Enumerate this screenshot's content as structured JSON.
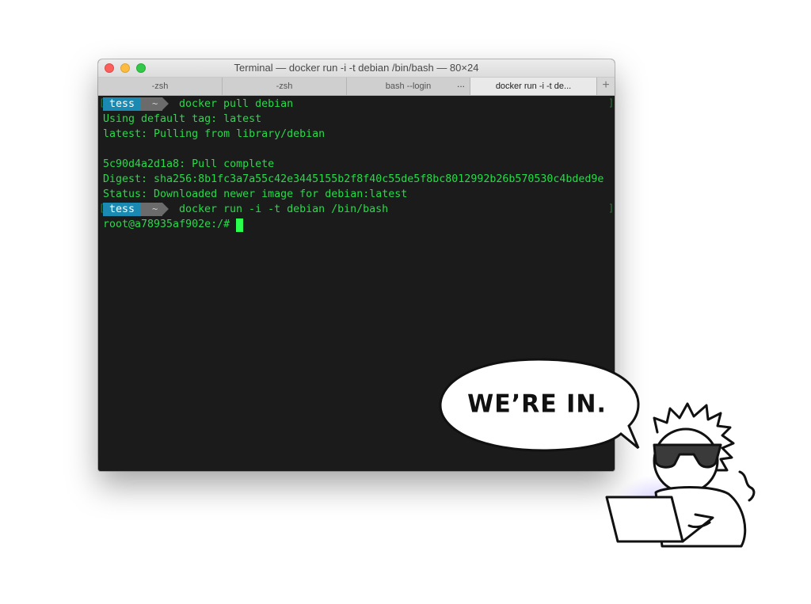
{
  "window": {
    "title": "Terminal — docker run -i -t debian /bin/bash — 80×24"
  },
  "tabs": [
    {
      "label": "-zsh",
      "active": false
    },
    {
      "label": "-zsh",
      "active": false
    },
    {
      "label": "bash --login",
      "active": false,
      "extra": "..."
    },
    {
      "label": "docker run -i -t de...",
      "active": true
    }
  ],
  "new_tab_label": "+",
  "terminal": {
    "prompt1": {
      "user": "tess",
      "dir": "~",
      "command": "docker pull debian"
    },
    "output": [
      "Using default tag: latest",
      "latest: Pulling from library/debian",
      "",
      "5c90d4a2d1a8: Pull complete",
      "Digest: sha256:8b1fc3a7a55c42e3445155b2f8f40c55de5f8bc8012992b26b570530c4bded9e",
      "Status: Downloaded newer image for debian:latest"
    ],
    "prompt2": {
      "user": "tess",
      "dir": "~",
      "command": "docker run -i -t debian /bin/bash"
    },
    "root_prompt": "root@a78935af902e:/# ",
    "bracket_left": "[",
    "bracket_right": "]"
  },
  "comic": {
    "speech": "WE’RE IN."
  },
  "colors": {
    "terminal_bg": "#1b1b1b",
    "terminal_text": "#28d94a",
    "prompt_user_bg": "#1b8ab2",
    "prompt_dir_bg": "#6b6b6b",
    "cursor": "#2bff4d"
  }
}
